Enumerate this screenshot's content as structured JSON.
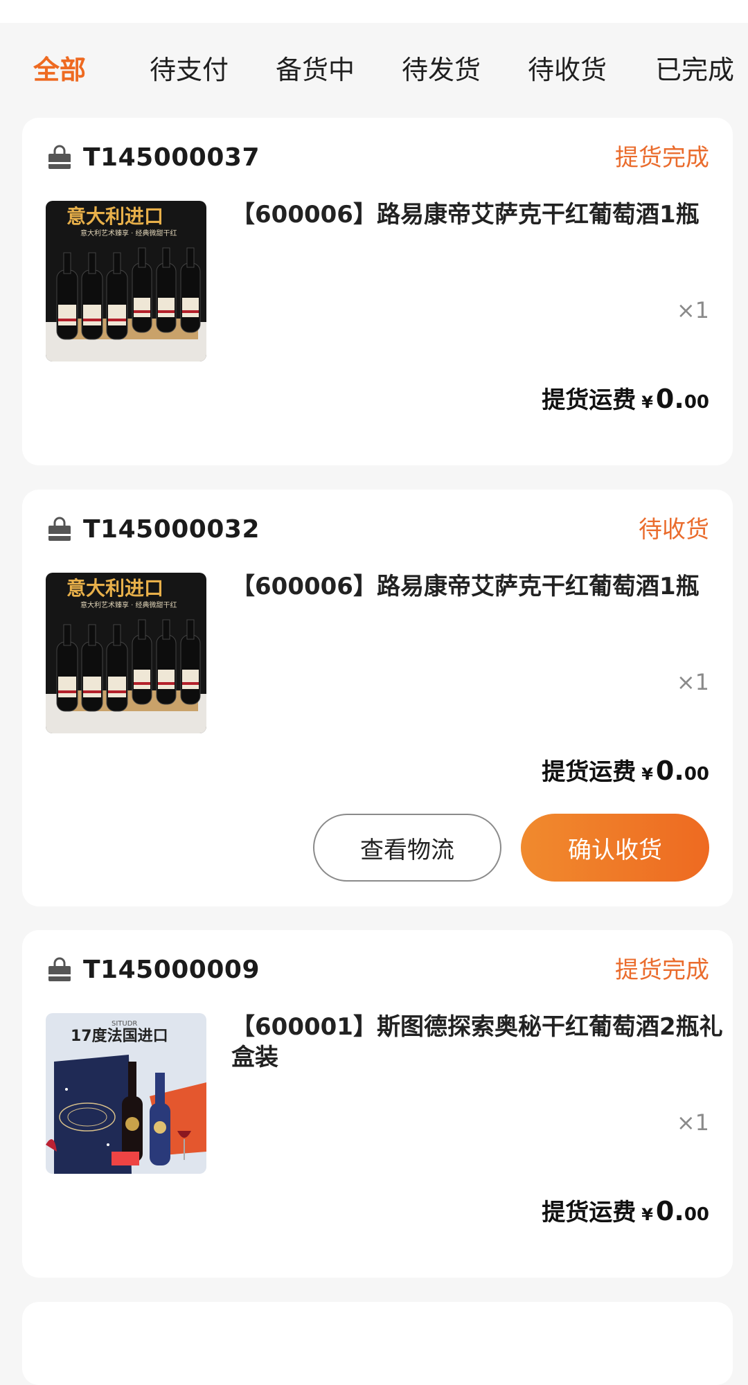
{
  "tabs": [
    {
      "label": "全部",
      "active": true
    },
    {
      "label": "待支付",
      "active": false
    },
    {
      "label": "备货中",
      "active": false
    },
    {
      "label": "待发货",
      "active": false
    },
    {
      "label": "待收货",
      "active": false
    },
    {
      "label": "已完成",
      "active": false
    }
  ],
  "orders": [
    {
      "id": "T145000037",
      "status": "提货完成",
      "product": {
        "title": "【600006】路易康帝艾萨克干红葡萄酒1瓶",
        "qty": "×1",
        "thumb_banner": "意大利进口",
        "thumb_sub": "意大利艺术臻享 · 经典微甜干红"
      },
      "fee_label": "提货运费",
      "currency": "¥",
      "fee_int": "0.",
      "fee_dec": "00"
    },
    {
      "id": "T145000032",
      "status": "待收货",
      "product": {
        "title": "【600006】路易康帝艾萨克干红葡萄酒1瓶",
        "qty": "×1",
        "thumb_banner": "意大利进口",
        "thumb_sub": "意大利艺术臻享 · 经典微甜干红"
      },
      "fee_label": "提货运费",
      "currency": "¥",
      "fee_int": "0.",
      "fee_dec": "00",
      "buttons": {
        "logistics": "查看物流",
        "confirm": "确认收货"
      }
    },
    {
      "id": "T145000009",
      "status": "提货完成",
      "product": {
        "title": "【600001】斯图德探索奥秘干红葡萄酒2瓶礼盒装",
        "qty": "×1",
        "thumb_brand": "SITUDR",
        "thumb_banner": "17度法国进口"
      },
      "fee_label": "提货运费",
      "currency": "¥",
      "fee_int": "0.",
      "fee_dec": "00"
    }
  ],
  "colors": {
    "accent": "#ee6a21",
    "status": "#ea6c2d",
    "background": "#f6f6f6",
    "card": "#ffffff"
  }
}
